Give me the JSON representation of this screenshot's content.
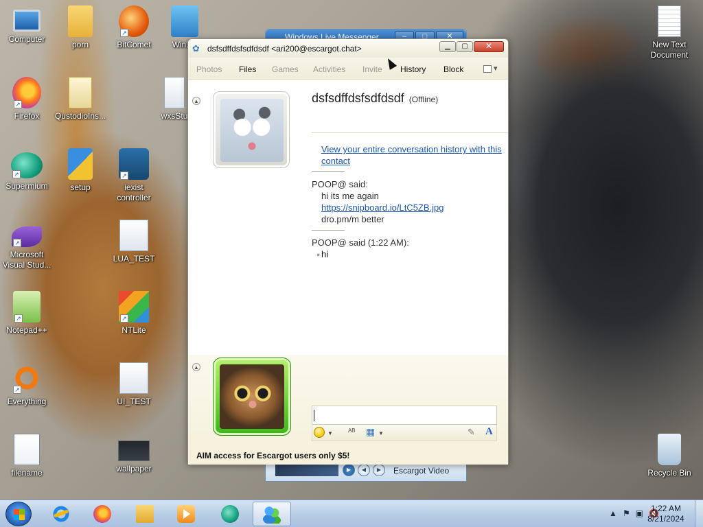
{
  "desktop": {
    "icons": [
      {
        "label": "Computer",
        "icon": "computer-icon"
      },
      {
        "label": "porn",
        "icon": "folder-icon"
      },
      {
        "label": "BitComet",
        "icon": "bitcomet-icon"
      },
      {
        "label": "WinXS",
        "icon": "winxs-icon"
      },
      {
        "label": "Firefox",
        "icon": "firefox-icon"
      },
      {
        "label": "QustodioIns...",
        "icon": "zip-folder-icon"
      },
      {
        "label": "wxsStu",
        "icon": "settings-file-icon"
      },
      {
        "label": "Supermium",
        "icon": "supermium-icon"
      },
      {
        "label": "setup",
        "icon": "setup-icon"
      },
      {
        "label": "iexist controller",
        "icon": "iexist-icon"
      },
      {
        "label": "Microsoft Visual Stud...",
        "icon": "visual-studio-icon"
      },
      {
        "label": "LUA_TEST",
        "icon": "settings-file-icon"
      },
      {
        "label": "Notepad++",
        "icon": "notepadpp-icon"
      },
      {
        "label": "NTLite",
        "icon": "ntlite-icon"
      },
      {
        "label": "Everything",
        "icon": "everything-icon"
      },
      {
        "label": "UI_TEST",
        "icon": "settings-file-icon"
      },
      {
        "label": "filename",
        "icon": "script-file-icon"
      },
      {
        "label": "wallpaper",
        "icon": "image-file-icon"
      },
      {
        "label": "New Text Document",
        "icon": "text-file-icon"
      },
      {
        "label": "Recycle Bin",
        "icon": "recycle-bin-icon"
      }
    ]
  },
  "background_window": {
    "title": "Windows Live Messenger",
    "footer_label": "Escargot Video"
  },
  "chat": {
    "title": "dsfsdffdsfsdfdsdf <ari200@escargot.chat>",
    "toolbar": {
      "photos": "Photos",
      "files": "Files",
      "games": "Games",
      "activities": "Activities",
      "invite": "Invite",
      "history": "History",
      "block": "Block"
    },
    "contact_name": "dsfsdffdsfsdfdsdf",
    "contact_status": "(Offline)",
    "history_link": "View your entire conversation history with this contact",
    "messages": [
      {
        "header": "POOP@ said:",
        "lines": [
          "hi its me again",
          "https://snipboard.io/LtC5ZB.jpg",
          "dro.pm/m better"
        ]
      },
      {
        "header": "POOP@ said (1:22 AM):",
        "lines": [
          "hi"
        ]
      }
    ],
    "ad_text": "AIM access for Escargot users only $5!"
  },
  "taskbar": {
    "time": "1:22 AM",
    "date": "8/21/2024"
  }
}
